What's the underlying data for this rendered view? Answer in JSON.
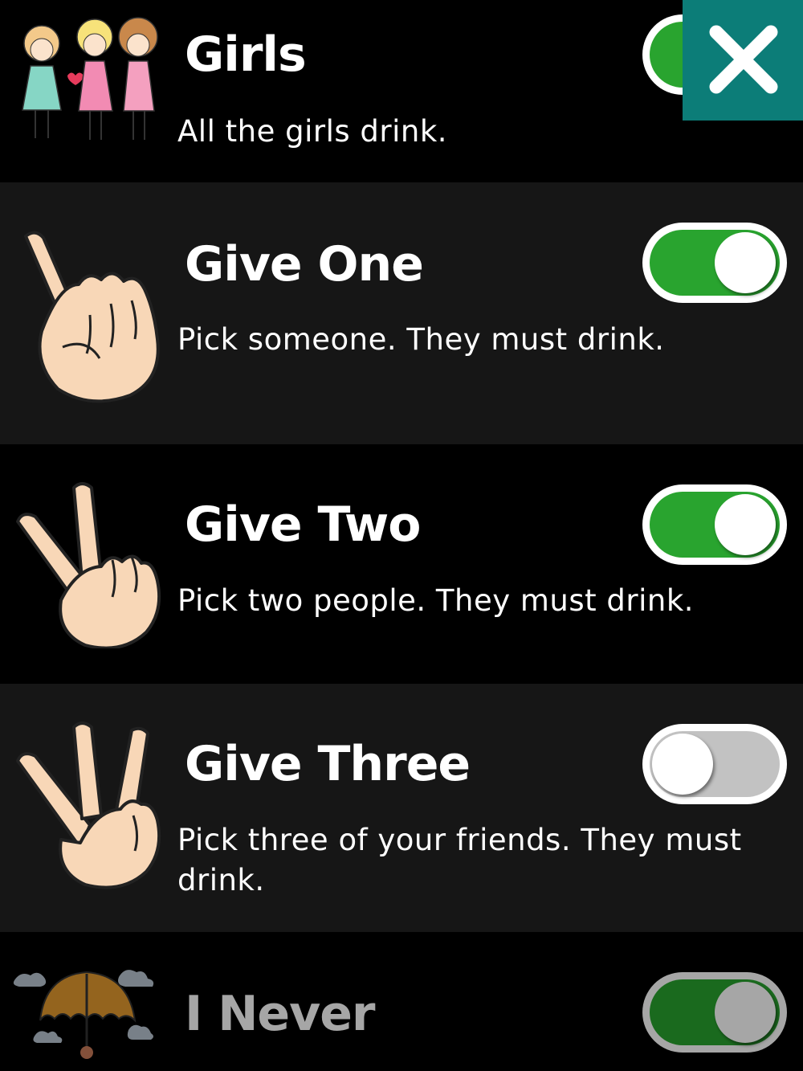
{
  "rules": [
    {
      "title": "Girls",
      "description": "All the girls drink.",
      "enabled": true,
      "icon": "girls-icon"
    },
    {
      "title": "Give One",
      "description": "Pick someone. They must drink.",
      "enabled": true,
      "icon": "one-finger-hand-icon"
    },
    {
      "title": "Give Two",
      "description": "Pick two people. They must drink.",
      "enabled": true,
      "icon": "two-finger-hand-icon"
    },
    {
      "title": "Give Three",
      "description": "Pick three of your friends. They must drink.",
      "enabled": false,
      "icon": "three-finger-hand-icon"
    },
    {
      "title": "I Never",
      "description": "",
      "enabled": true,
      "icon": "umbrella-icon"
    }
  ],
  "close_icon": "close-icon",
  "colors": {
    "toggle_on": "#29a42f",
    "toggle_off": "#c2c2c2",
    "close_bg": "#0c7d78",
    "row_alt": "#161616"
  }
}
